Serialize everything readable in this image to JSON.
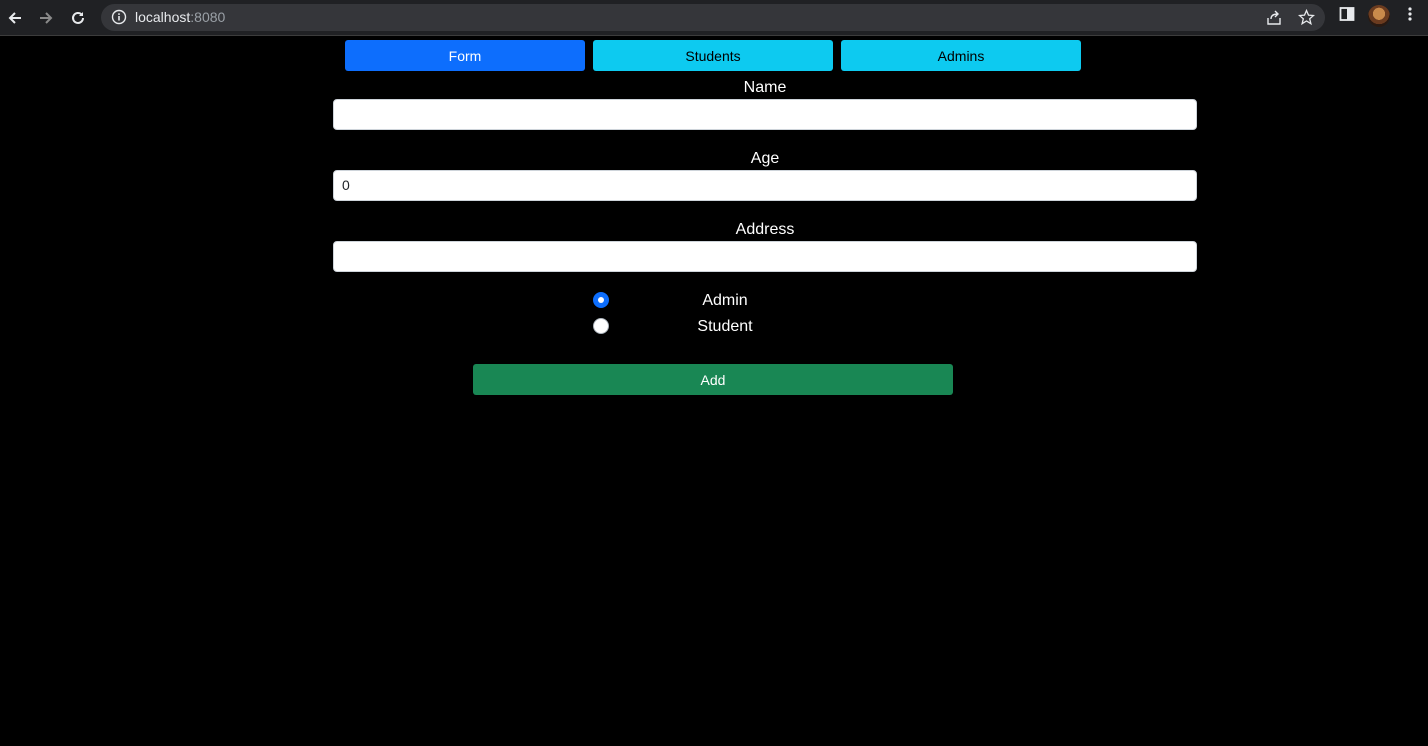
{
  "browser": {
    "url_host": "localhost",
    "url_port": ":8080"
  },
  "tabs": [
    {
      "label": "Form",
      "active": true,
      "color": "#0d6efd"
    },
    {
      "label": "Students",
      "active": false,
      "color": "#0dcaf0"
    },
    {
      "label": "Admins",
      "active": false,
      "color": "#0dcaf0"
    }
  ],
  "form": {
    "name": {
      "label": "Name",
      "value": ""
    },
    "age": {
      "label": "Age",
      "value": "0"
    },
    "address": {
      "label": "Address",
      "value": ""
    },
    "role": {
      "options": [
        {
          "label": "Admin",
          "checked": true
        },
        {
          "label": "Student",
          "checked": false
        }
      ]
    },
    "submit_label": "Add",
    "submit_color": "#198754"
  }
}
